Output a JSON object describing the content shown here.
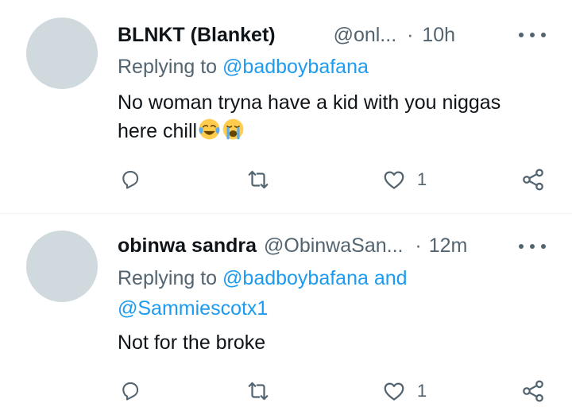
{
  "tweets": [
    {
      "display_name": "BLNKT (Blanket)",
      "handle": "@onl...",
      "dot": "·",
      "time": "10h",
      "replying_prefix": "Replying to",
      "replying_line1": "@badboybafana",
      "replying_line2": "",
      "text_line1": "No woman tryna have a kid with you niggas",
      "text_line2": "here chill",
      "emojis": [
        "face-with-tears-of-joy-icon",
        "loudly-crying-face-icon"
      ],
      "like_count": "1"
    },
    {
      "display_name": "obinwa sandra",
      "handle": "@ObinwaSan...",
      "dot": "·",
      "time": "12m",
      "replying_prefix": "Replying to",
      "replying_line1": "@badboybafana and",
      "replying_line2": "@Sammiescotx1",
      "text_line1": "Not for the broke",
      "text_line2": "",
      "emojis": [],
      "like_count": "1"
    }
  ],
  "colors": {
    "accent": "#1d9bf0",
    "secondary_text": "#536471",
    "primary_text": "#0f1419",
    "avatar_placeholder": "#cfd9de",
    "divider": "#eff3f4"
  }
}
